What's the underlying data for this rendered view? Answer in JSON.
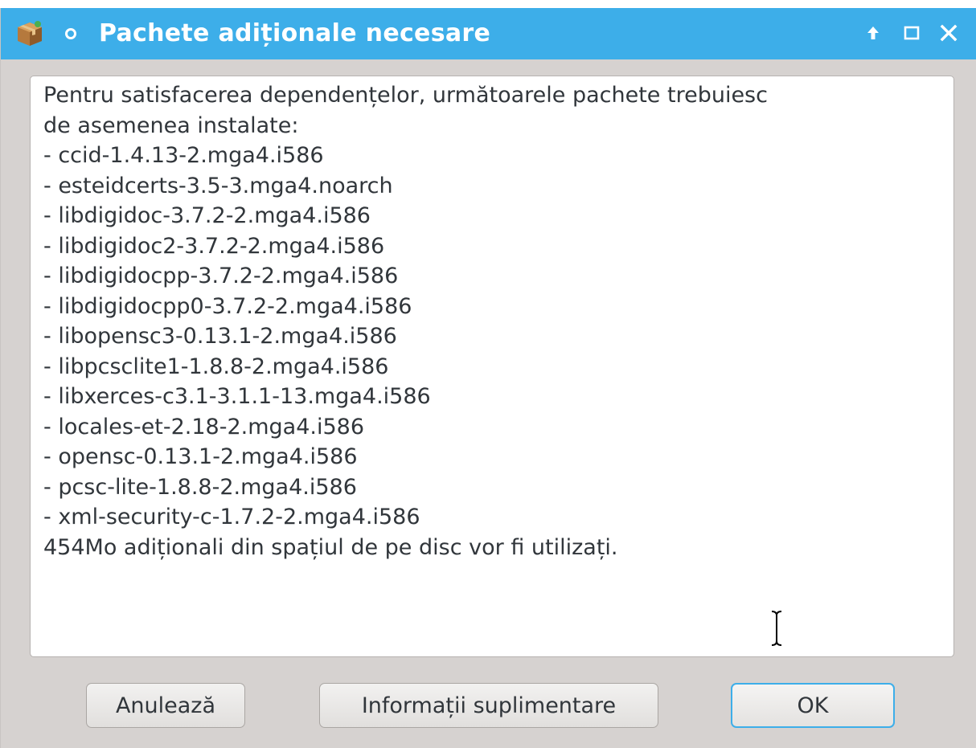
{
  "window": {
    "title": "Pachete adiționale necesare",
    "controls": [
      "keep-above-icon",
      "maximize-icon",
      "close-icon"
    ]
  },
  "message": {
    "lines": [
      "Pentru satisfacerea dependențelor, următoarele pachete trebuiesc",
      "de asemenea instalate:",
      "",
      "- ccid-1.4.13-2.mga4.i586",
      "- esteidcerts-3.5-3.mga4.noarch",
      "- libdigidoc-3.7.2-2.mga4.i586",
      "- libdigidoc2-3.7.2-2.mga4.i586",
      "- libdigidocpp-3.7.2-2.mga4.i586",
      "- libdigidocpp0-3.7.2-2.mga4.i586",
      "- libopensc3-0.13.1-2.mga4.i586",
      "- libpcsclite1-1.8.8-2.mga4.i586",
      "- libxerces-c3.1-3.1.1-13.mga4.i586",
      "- locales-et-2.18-2.mga4.i586",
      "- opensc-0.13.1-2.mga4.i586",
      "- pcsc-lite-1.8.8-2.mga4.i586",
      "- xml-security-c-1.7.2-2.mga4.i586",
      "",
      "454Mo adiționali din spațiul de pe disc vor fi utilizați."
    ]
  },
  "buttons": {
    "cancel": "Anulează",
    "more_info": "Informații suplimentare",
    "ok": "OK"
  },
  "colors": {
    "titlebar": "#3daee9",
    "window_bg": "#d6d2d0",
    "text": "#31363b"
  }
}
